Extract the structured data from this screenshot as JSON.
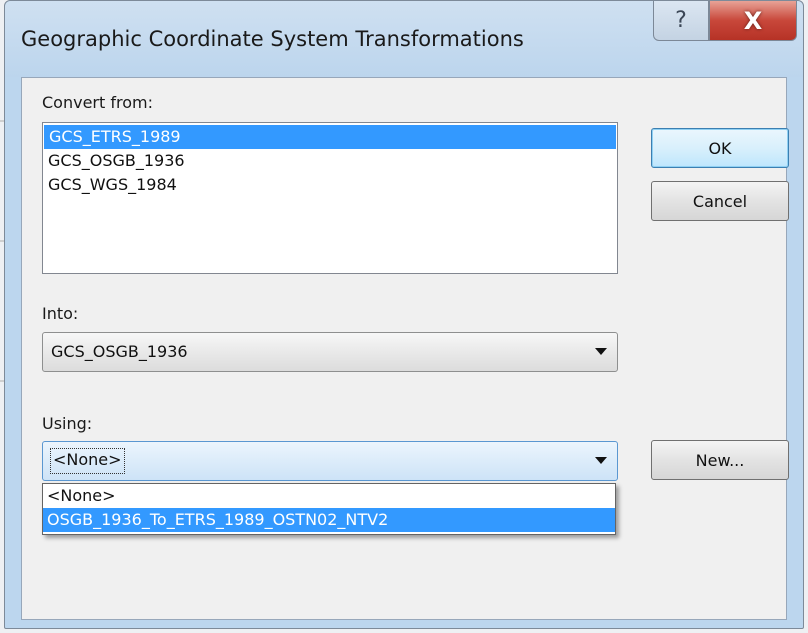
{
  "dialog": {
    "title": "Geographic Coordinate System Transformations",
    "help_glyph": "?",
    "close_glyph": "X"
  },
  "convert_from": {
    "label": "Convert from:",
    "items": [
      "GCS_ETRS_1989",
      "GCS_OSGB_1936",
      "GCS_WGS_1984"
    ],
    "selected_index": 0
  },
  "into": {
    "label": "Into:",
    "value": "GCS_OSGB_1936"
  },
  "using": {
    "label": "Using:",
    "value": "<None>",
    "options": [
      "<None>",
      "OSGB_1936_To_ETRS_1989_OSTN02_NTV2"
    ],
    "highlighted_index": 1
  },
  "buttons": {
    "ok": "OK",
    "cancel": "Cancel",
    "new": "New..."
  },
  "colors": {
    "selection": "#3399ff",
    "close_button": "#c8473a",
    "frame": "#bcd6ee"
  },
  "icons": {
    "help": "help-icon",
    "close": "close-icon",
    "dropdown_arrow": "chevron-down-icon"
  }
}
